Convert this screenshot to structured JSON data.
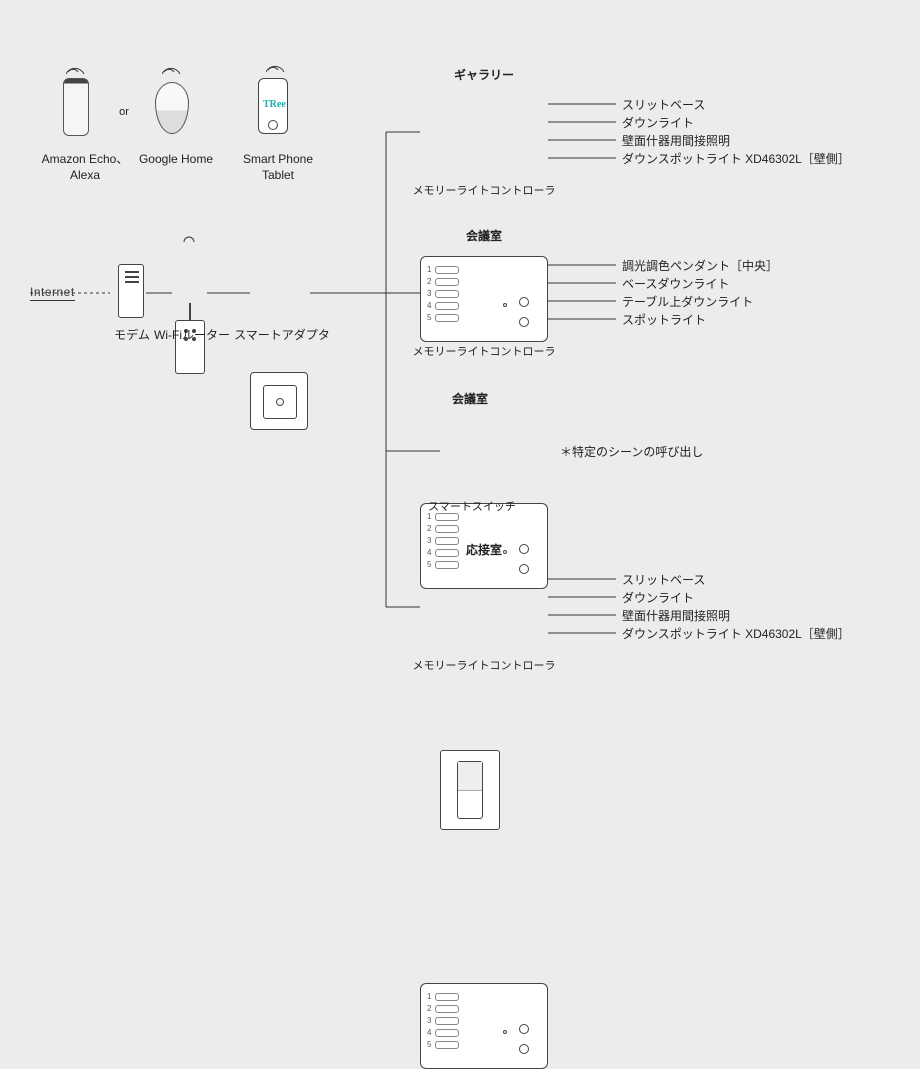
{
  "voice": {
    "echo_label": "Amazon Echo、Alexa",
    "or_label": "or",
    "ghome_label": "Google Home",
    "phone_label": "Smart Phone\nTablet",
    "phone_brand": "TRee"
  },
  "network": {
    "internet_label": "Internet",
    "modem_label": "モデム",
    "router_label": "Wi-Fiルーター",
    "adapter_label": "スマートアダプタ"
  },
  "controller_caption": "メモリーライトコントローラ",
  "smart_switch_caption": "スマートスイッチ",
  "scene_note": "＊特定のシーンの呼び出し",
  "blocks": [
    {
      "title": "ギャラリー",
      "outputs": [
        "スリットベース",
        "ダウンライト",
        "壁面什器用間接照明",
        "ダウンスポットライト  XD46302L［壁側］"
      ]
    },
    {
      "title": "会議室",
      "outputs": [
        "調光調色ペンダント［中央］",
        "ベースダウンライト",
        "テーブル上ダウンライト",
        "スポットライト"
      ]
    },
    {
      "title": "会議室",
      "outputs": []
    },
    {
      "title": "応接室",
      "outputs": [
        "スリットベース",
        "ダウンライト",
        "壁面什器用間接照明",
        "ダウンスポットライト  XD46302L［壁側］"
      ]
    }
  ]
}
